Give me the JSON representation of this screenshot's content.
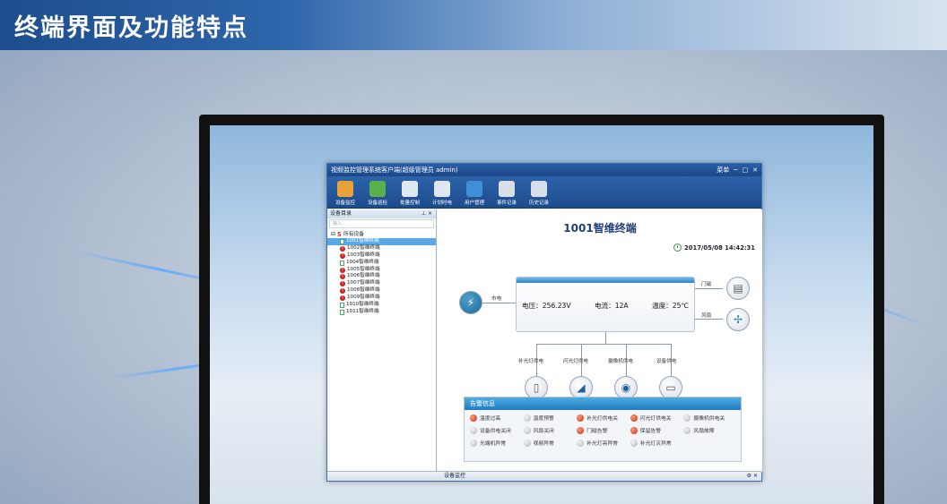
{
  "slide": {
    "title": "终端界面及功能特点"
  },
  "window": {
    "title": "视频监控管理系统客户端(超级管理员 admin)",
    "controls": [
      "菜单",
      "─",
      "□",
      "✕"
    ]
  },
  "toolbar": [
    {
      "label": "设备监控",
      "icon": "monitor-icon",
      "color": "#e8a23a"
    },
    {
      "label": "设备巡检",
      "icon": "inspect-icon",
      "color": "#5ab04a"
    },
    {
      "label": "批量控制",
      "icon": "batch-icon",
      "color": "#dfe7f0"
    },
    {
      "label": "计划时电",
      "icon": "clock-icon",
      "color": "#dfe7f0"
    },
    {
      "label": "用户管理",
      "icon": "users-icon",
      "color": "#3f8fd6"
    },
    {
      "label": "事件记录",
      "icon": "database-icon",
      "color": "#d8dfe8"
    },
    {
      "label": "历史记录",
      "icon": "history-icon",
      "color": "#d8dfe8"
    }
  ],
  "sidebar": {
    "header": "设备目录",
    "search_placeholder": "输入...",
    "root_label": "所有设备",
    "items": [
      {
        "label": "1001智维终端",
        "selected": true,
        "status": "doc"
      },
      {
        "label": "1002智维终端",
        "selected": false,
        "status": "alarm"
      },
      {
        "label": "1003智维终端",
        "selected": false,
        "status": "alarm"
      },
      {
        "label": "1004智维终端",
        "selected": false,
        "status": "doc"
      },
      {
        "label": "1005智维终端",
        "selected": false,
        "status": "alarm"
      },
      {
        "label": "1006智维终端",
        "selected": false,
        "status": "alarm"
      },
      {
        "label": "1007智维终端",
        "selected": false,
        "status": "alarm"
      },
      {
        "label": "1008智维终端",
        "selected": false,
        "status": "alarm"
      },
      {
        "label": "1009智维终端",
        "selected": false,
        "status": "alarm"
      },
      {
        "label": "1010智维终端",
        "selected": false,
        "status": "doc"
      },
      {
        "label": "1011智维终端",
        "selected": false,
        "status": "doc"
      }
    ]
  },
  "terminal": {
    "name": "1001智维终端",
    "datetime": "2017/05/08 14:42:31",
    "voltage": "电压：256.23V",
    "current": "电流：12A",
    "temperature": "温度：25℃",
    "labels": {
      "mains": "市电",
      "door": "门磁",
      "fan": "风扇",
      "fill_light": "补光灯供电",
      "flash_light": "闪光灯供电",
      "camera": "摄像机供电",
      "device": "设备供电"
    }
  },
  "alarms": {
    "title": "告警信息",
    "items": [
      {
        "label": "温度过高",
        "state": "red"
      },
      {
        "label": "温度预警",
        "state": "gray"
      },
      {
        "label": "补光灯供电关",
        "state": "red"
      },
      {
        "label": "闪光灯供电关",
        "state": "red"
      },
      {
        "label": "摄像机供电关",
        "state": "gray"
      },
      {
        "label": "设备供电关闭",
        "state": "gray"
      },
      {
        "label": "风扇关闭",
        "state": "gray"
      },
      {
        "label": "门磁告警",
        "state": "red"
      },
      {
        "label": "保留告警",
        "state": "red"
      },
      {
        "label": "风扇故障",
        "state": "gray"
      },
      {
        "label": "光端机异常",
        "state": "gray"
      },
      {
        "label": "视频异常",
        "state": "gray"
      },
      {
        "label": "补光灯亮异常",
        "state": "gray"
      },
      {
        "label": "补光灯灭异常",
        "state": "gray"
      }
    ]
  },
  "statusbar": {
    "label": "设备监控"
  }
}
